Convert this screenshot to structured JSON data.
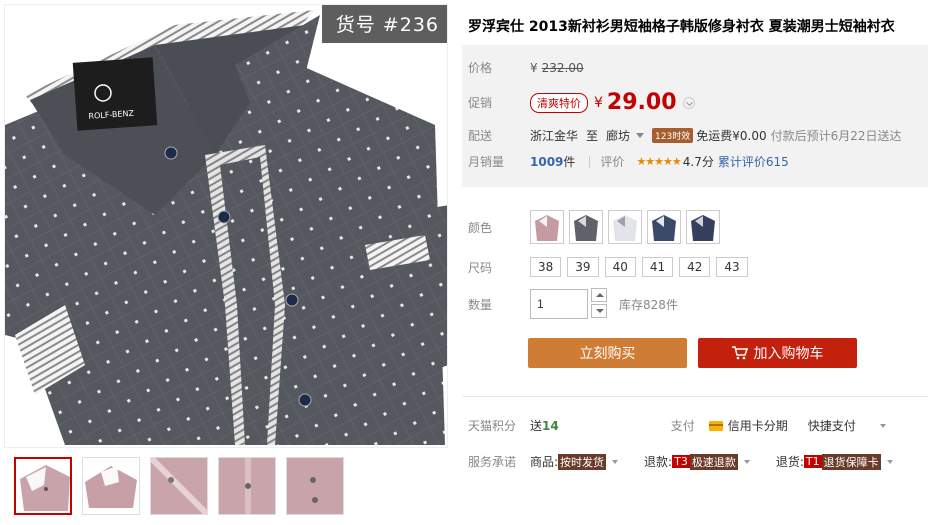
{
  "gallery": {
    "sku_tag": "货号 #236",
    "main_image_alt": "ROLF-BENZ",
    "brand_cn": "罗浮·宾仕",
    "brand_en": "ROLF-BENZ",
    "thumbnail_count": 5
  },
  "product": {
    "title": "罗浮宾仕 2013新衬衫男短袖格子韩版修身衬衣 夏装潮男士短袖衬衣"
  },
  "price": {
    "label": "价格",
    "currency": "¥",
    "original": "232.00"
  },
  "promo": {
    "label": "促销",
    "tag": "清爽特价",
    "currency": "¥",
    "price": "29.00"
  },
  "shipping": {
    "label": "配送",
    "from": "浙江金华",
    "to_word": "至",
    "to": "廊坊",
    "badge": "123时效",
    "fee": "免运费¥0.00",
    "eta": "付款后预计6月22日送达"
  },
  "sales": {
    "label": "月销量",
    "count": "1009",
    "unit": "件",
    "rating_label": "评价",
    "stars": "★★★★★",
    "score": "4.7分",
    "review_link": "累计评价615"
  },
  "colors": {
    "label": "颜色",
    "swatches": [
      "pink",
      "gray",
      "white",
      "navy",
      "navy-dark"
    ]
  },
  "sizes": {
    "label": "尺码",
    "options": [
      "38",
      "39",
      "40",
      "41",
      "42",
      "43"
    ]
  },
  "quantity": {
    "label": "数量",
    "value": "1",
    "stock": "库存828件"
  },
  "actions": {
    "buy_now": "立刻购买",
    "add_cart": "加入购物车"
  },
  "points": {
    "label": "天猫积分",
    "send_word": "送",
    "value": "14",
    "pay_label": "支付",
    "credit": "信用卡分期",
    "quick": "快捷支付"
  },
  "services": {
    "label": "服务承诺",
    "items": [
      {
        "prefix": "商品:",
        "tag": "按时发货",
        "code": ""
      },
      {
        "prefix": "退款:",
        "tag": "极速退款",
        "code": "T3"
      },
      {
        "prefix": "退货:",
        "tag": "退货保障卡",
        "code": "T1"
      }
    ]
  },
  "colors_hex": {
    "accent_red": "#c40000",
    "buy_orange": "#cf7c35",
    "cart_red": "#c3200d",
    "link_blue": "#3366aa",
    "star_orange": "#e48b00"
  }
}
